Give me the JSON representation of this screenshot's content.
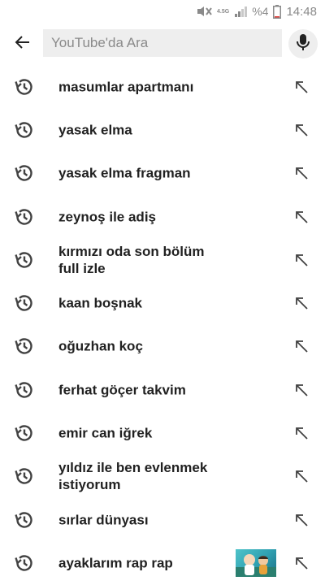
{
  "status_bar": {
    "network_label": "4.5G",
    "battery_percent": "%4",
    "time": "14:48",
    "icons": [
      "mute-icon",
      "signal-icon",
      "battery-icon"
    ]
  },
  "search": {
    "placeholder": "YouTube'da Ara",
    "value": ""
  },
  "history": [
    {
      "label": "masumlar apartmanı"
    },
    {
      "label": "yasak elma"
    },
    {
      "label": "yasak elma fragman"
    },
    {
      "label": "zeynoş ile adiş"
    },
    {
      "label": "kırmızı oda son bölüm full izle"
    },
    {
      "label": "kaan boşnak"
    },
    {
      "label": "oğuzhan koç"
    },
    {
      "label": "ferhat göçer takvim"
    },
    {
      "label": "emir can iğrek"
    },
    {
      "label": "yıldız ile ben evlenmek istiyorum"
    },
    {
      "label": "sırlar dünyası"
    },
    {
      "label": "ayaklarım rap rap",
      "has_thumbnail": true
    }
  ],
  "colors": {
    "icon_gray": "#424242",
    "status_gray": "#8a8a8a",
    "input_bg": "#eeeeee"
  }
}
